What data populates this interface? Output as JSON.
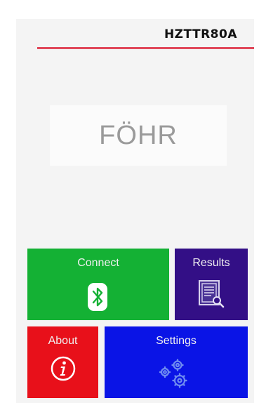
{
  "header": {
    "device_id": "HZTTR80A"
  },
  "logo": {
    "text": "FÖHR"
  },
  "tiles": {
    "connect": {
      "label": "Connect",
      "icon": "bluetooth-icon",
      "color": "#14b134"
    },
    "results": {
      "label": "Results",
      "icon": "document-search-icon",
      "color": "#330f86"
    },
    "about": {
      "label": "About",
      "icon": "info-icon",
      "color": "#e8101a"
    },
    "settings": {
      "label": "Settings",
      "icon": "gears-icon",
      "color": "#0a14e6"
    }
  },
  "colors": {
    "header_line": "#e0485a"
  }
}
